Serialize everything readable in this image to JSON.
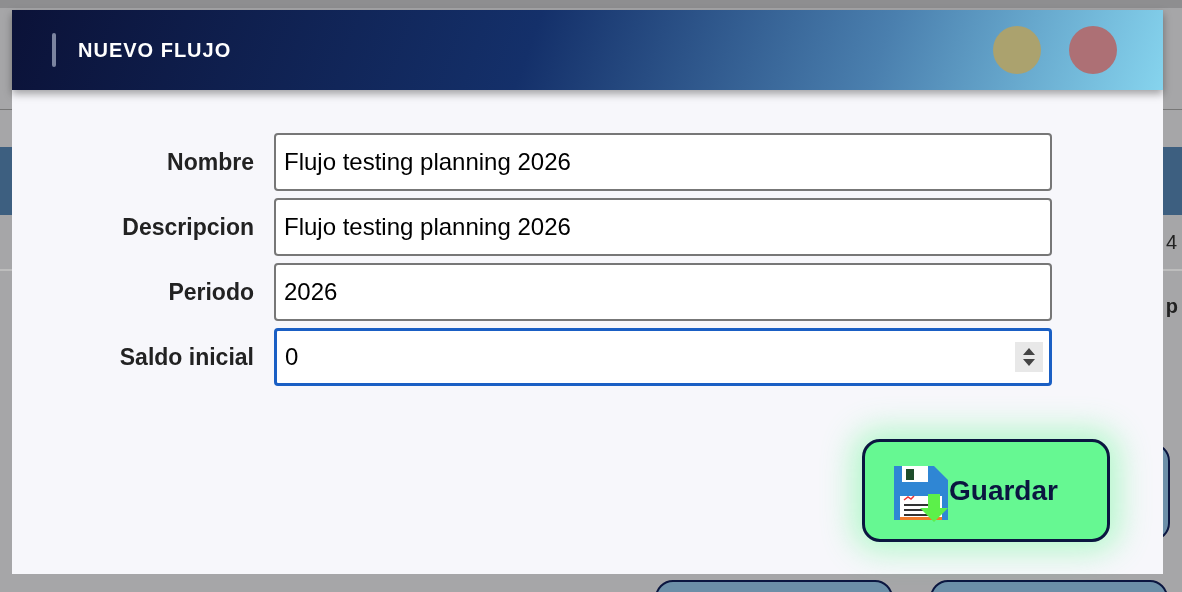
{
  "background": {
    "fragments": [
      "4",
      "p"
    ]
  },
  "dialog": {
    "title": "NUEVO FLUJO",
    "fields": [
      {
        "label": "Nombre",
        "value": "Flujo testing planning 2026",
        "kind": "text",
        "focused": false
      },
      {
        "label": "Descripcion",
        "value": "Flujo testing planning 2026",
        "kind": "text",
        "focused": false
      },
      {
        "label": "Periodo",
        "value": "2026",
        "kind": "text",
        "focused": false
      },
      {
        "label": "Saldo inicial",
        "value": "0",
        "kind": "number",
        "focused": true
      }
    ],
    "save_button": {
      "label": "Guardar"
    }
  }
}
